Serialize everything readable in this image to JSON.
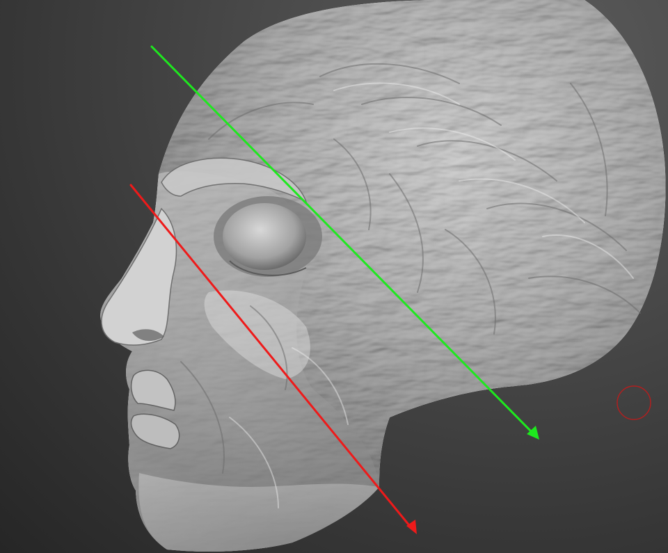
{
  "viewport": {
    "background_top": "#5a5a5a",
    "background_bottom": "#252525"
  },
  "model": {
    "name": "sculpted-head",
    "material_color": "#a8a8a8",
    "highlight_color": "#e8e8e8",
    "shadow_color": "#4c4c4c"
  },
  "guides": {
    "green_color": "#1ee81e",
    "red_color": "#ee1a1a"
  },
  "brush_cursor": {
    "color": "#b21f1f"
  }
}
